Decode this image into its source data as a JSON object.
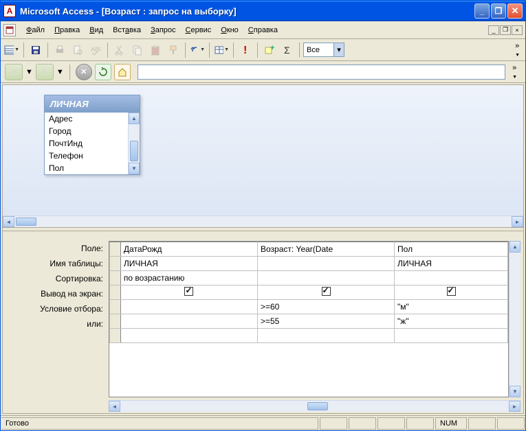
{
  "titlebar": {
    "title": "Microsoft Access - [Возраст : запрос на выборку]",
    "app_icon_letter": "A"
  },
  "menubar": {
    "items": [
      {
        "label": "Файл",
        "u": 0
      },
      {
        "label": "Правка",
        "u": 0
      },
      {
        "label": "Вид",
        "u": 0
      },
      {
        "label": "Вставка",
        "u": 3
      },
      {
        "label": "Запрос",
        "u": 0
      },
      {
        "label": "Сервис",
        "u": 0
      },
      {
        "label": "Окно",
        "u": 0
      },
      {
        "label": "Справка",
        "u": 0
      }
    ]
  },
  "toolbar": {
    "combo_value": "Все"
  },
  "table_box": {
    "title": "ЛИЧНАЯ",
    "fields": [
      "Адрес",
      "Город",
      "ПочтИнд",
      "Телефон",
      "Пол"
    ]
  },
  "grid": {
    "labels": {
      "field": "Поле:",
      "table": "Имя таблицы:",
      "sort": "Сортировка:",
      "show": "Вывод на экран:",
      "criteria": "Условие отбора:",
      "or": "или:"
    },
    "columns": [
      {
        "field": "ДатаРожд",
        "table": "ЛИЧНАЯ",
        "sort": "по возрастанию",
        "show": true,
        "criteria": "",
        "or": ""
      },
      {
        "field": "Возраст: Year(Date",
        "table": "",
        "sort": "",
        "show": true,
        "criteria": ">=60",
        "or": ">=55"
      },
      {
        "field": "Пол",
        "table": "ЛИЧНАЯ",
        "sort": "",
        "show": true,
        "criteria": "\"м\"",
        "or": "\"ж\""
      }
    ]
  },
  "statusbar": {
    "ready": "Готово",
    "num": "NUM"
  }
}
